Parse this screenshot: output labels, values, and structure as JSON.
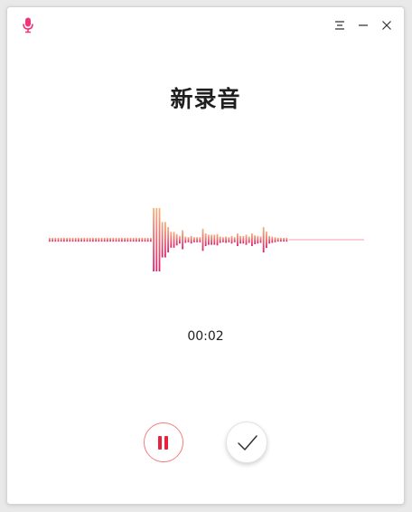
{
  "app": {
    "icon": "microphone-icon",
    "accent": "#e8213d"
  },
  "titlebar": {
    "menu_icon": "menu-icon",
    "minimize_icon": "minimize-icon",
    "close_icon": "close-icon"
  },
  "recording": {
    "title": "新录音",
    "elapsed": "00:02"
  },
  "controls": {
    "pause_icon": "pause-icon",
    "finish_icon": "checkmark-icon"
  },
  "waveform": {
    "amplitudes": [
      0.06,
      0.06,
      0.06,
      0.06,
      0.06,
      0.06,
      0.06,
      0.06,
      0.06,
      0.06,
      0.06,
      0.06,
      0.06,
      0.06,
      0.06,
      0.06,
      0.06,
      0.06,
      0.06,
      0.06,
      0.06,
      0.06,
      0.06,
      0.06,
      0.06,
      0.06,
      0.06,
      0.06,
      0.06,
      0.06,
      0.06,
      0.06,
      0.06,
      0.06,
      0.06,
      0.06,
      1.0,
      1.0,
      1.0,
      0.56,
      0.56,
      0.4,
      0.25,
      0.25,
      0.18,
      0.12,
      0.3,
      0.1,
      0.08,
      0.12,
      0.08,
      0.08,
      0.08,
      0.35,
      0.2,
      0.16,
      0.16,
      0.16,
      0.18,
      0.1,
      0.08,
      0.1,
      0.08,
      0.12,
      0.08,
      0.2,
      0.12,
      0.12,
      0.16,
      0.1,
      0.2,
      0.14,
      0.12,
      0.1,
      0.4,
      0.26,
      0.12,
      0.1,
      0.08,
      0.06,
      0.06,
      0.06,
      0.06
    ],
    "color_top": "#f5b27a",
    "color_bottom": "#e0206e",
    "line_color": "#f0a0b0"
  }
}
